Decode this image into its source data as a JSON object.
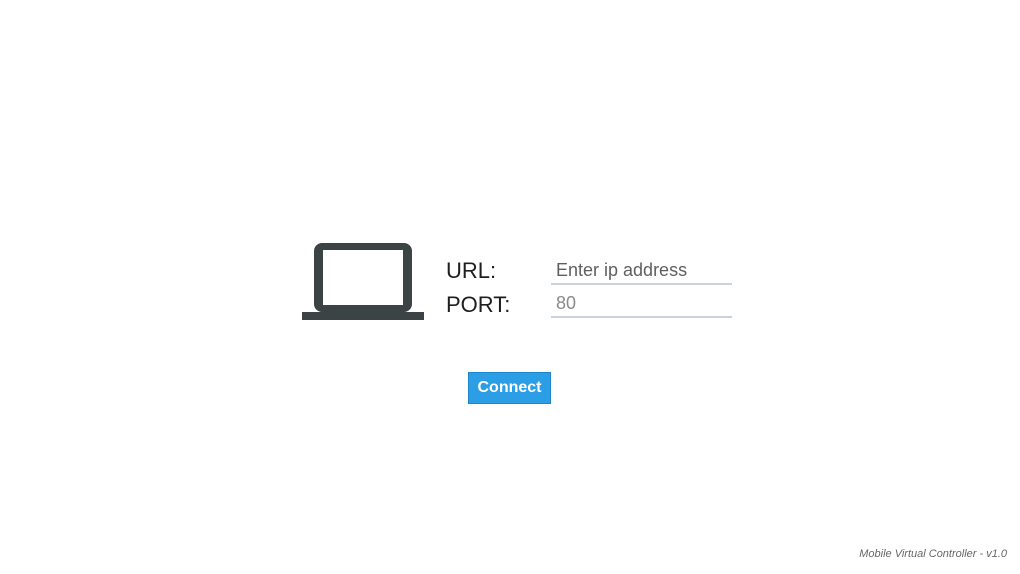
{
  "icon": {
    "laptop": "laptop-icon"
  },
  "form": {
    "url_label": "URL:",
    "url_placeholder": "Enter ip address",
    "url_value": "",
    "port_label": "PORT:",
    "port_value": "80"
  },
  "actions": {
    "connect_label": "Connect"
  },
  "footer": {
    "version_text": "Mobile Virtual Controller - v1.0"
  },
  "colors": {
    "accent": "#2b9ee6",
    "icon": "#3c4345",
    "field_underline": "#c8d3dc"
  }
}
